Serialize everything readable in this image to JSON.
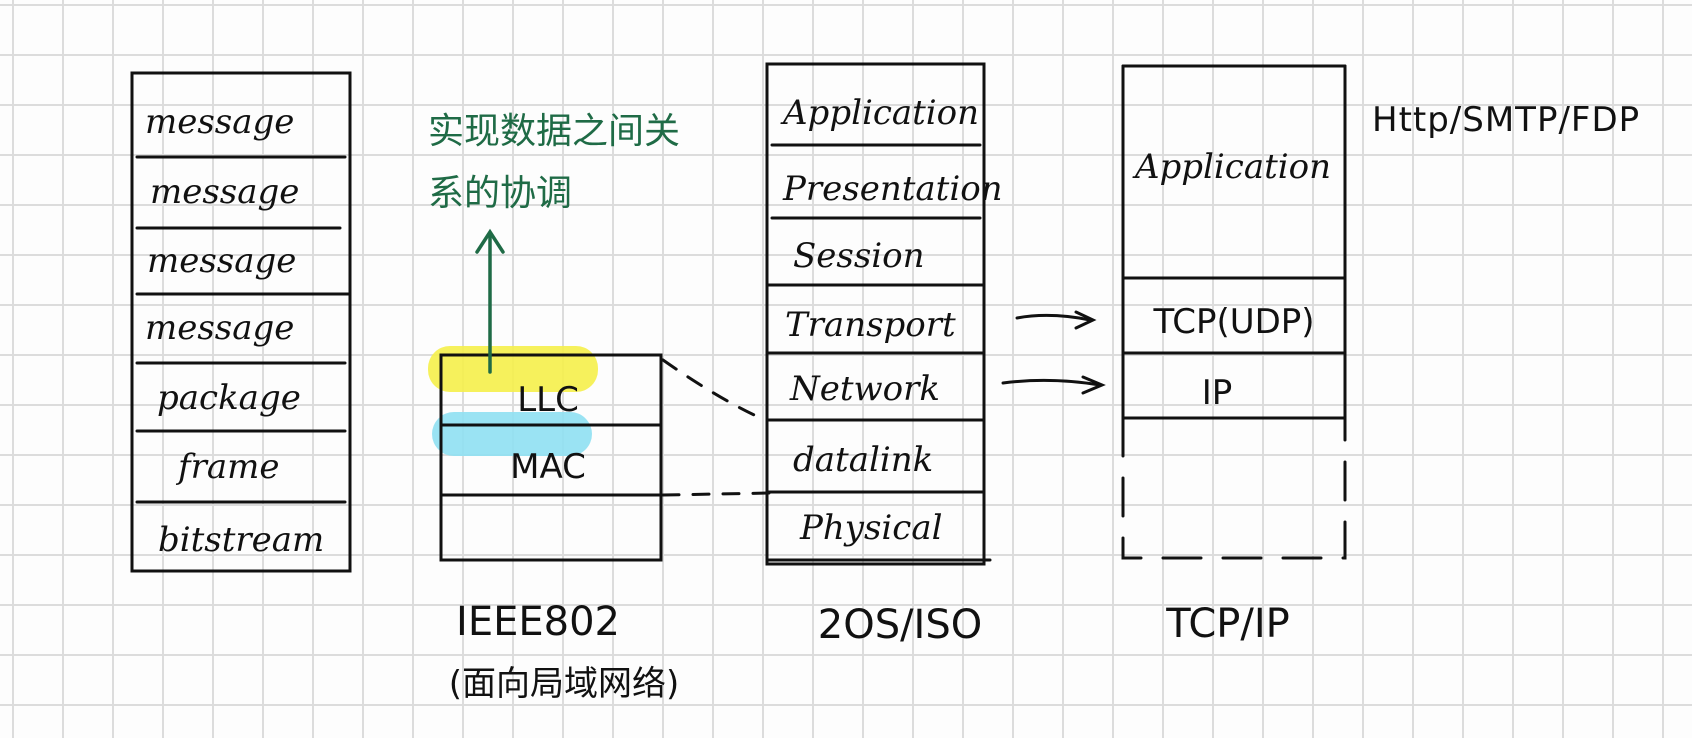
{
  "colors": {
    "ink": "#111111",
    "note_green": "#1f6b46",
    "llc_highlight": "#f5f04a",
    "mac_highlight": "#8fe0f2",
    "grid": "#dcdcdc"
  },
  "data_units_stack": {
    "items": [
      "message",
      "message",
      "message",
      "message",
      "package",
      "frame",
      "bitstream"
    ]
  },
  "ieee": {
    "llc": "LLC",
    "mac": "MAC",
    "caption": "IEEE802",
    "subcaption": "(面向局域网络)",
    "note_line1": "实现数据之间关",
    "note_line2": "系的协调"
  },
  "osi": {
    "layers": [
      "Application",
      "Presentation",
      "Session",
      "Transport",
      "Network",
      "datalink",
      "Physical"
    ],
    "caption": "2OS/ISO"
  },
  "tcpip": {
    "application": "Application",
    "transport": "TCP(UDP)",
    "internet": "IP",
    "caption": "TCP/IP",
    "protocols": "Http/SMTP/FDP"
  },
  "icons": {
    "up_arrow": "up-arrow-icon",
    "mapping_arrow": "right-arrow-icon"
  }
}
